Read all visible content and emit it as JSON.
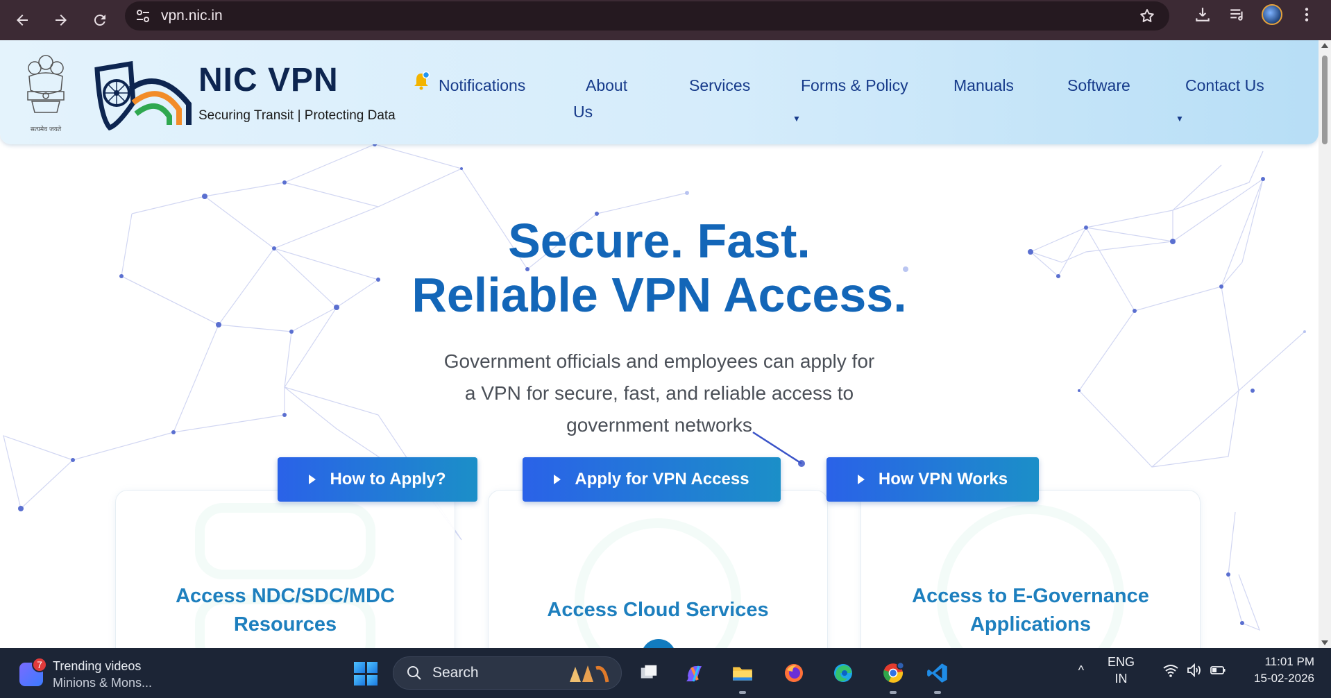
{
  "browser": {
    "url": "vpn.nic.in"
  },
  "header": {
    "emblem_motto": "सत्यमेव जयते",
    "brand_title": "NIC VPN",
    "brand_tagline": "Securing Transit | Protecting Data"
  },
  "nav": {
    "notifications": "Notifications",
    "about_line1": "About",
    "about_line2": "Us",
    "services": "Services",
    "forms_policy": "Forms & Policy",
    "manuals": "Manuals",
    "software": "Software",
    "contact": "Contact Us"
  },
  "hero": {
    "title_line1": "Secure. Fast.",
    "title_line2": "Reliable VPN Access.",
    "subtitle_line1": "Government officials and employees can apply for",
    "subtitle_line2": "a VPN for secure, fast, and reliable access to",
    "subtitle_line3": "government networks"
  },
  "cta": {
    "how_to_apply": "How to Apply?",
    "apply_vpn": "Apply for VPN Access",
    "how_vpn_works": "How VPN Works"
  },
  "cards": {
    "ndc_line1": "Access NDC/SDC/MDC",
    "ndc_line2": "Resources",
    "cloud": "Access Cloud Services",
    "egov_line1": "Access to E-Governance",
    "egov_line2": "Applications",
    "plus": "+"
  },
  "taskbar": {
    "widget_badge": "7",
    "widget_title": "Trending videos",
    "widget_sub": "Minions & Mons...",
    "search": "Search",
    "lang_line1": "ENG",
    "lang_line2": "IN",
    "time": "11:01 PM",
    "date": "15-02-2026",
    "tray_chevron": "^"
  },
  "colors": {
    "brand_navy": "#0d2550",
    "nav_text": "#163a8a",
    "hero_blue": "#1366b8",
    "card_title": "#1d7fbe",
    "cta_start": "#2a62e8",
    "cta_end": "#1b8fc8",
    "chrome_bg": "#3c2a34",
    "taskbar_bg": "#1c2536"
  },
  "icons": [
    "back-arrow-icon",
    "forward-arrow-icon",
    "reload-icon",
    "site-settings-icon",
    "bookmark-star-icon",
    "download-icon",
    "media-queue-icon",
    "profile-avatar-icon",
    "menu-dots-icon",
    "bell-icon",
    "play-triangle-icon",
    "plus-icon",
    "windows-start-icon",
    "search-icon",
    "wifi-icon",
    "volume-icon",
    "battery-icon"
  ]
}
